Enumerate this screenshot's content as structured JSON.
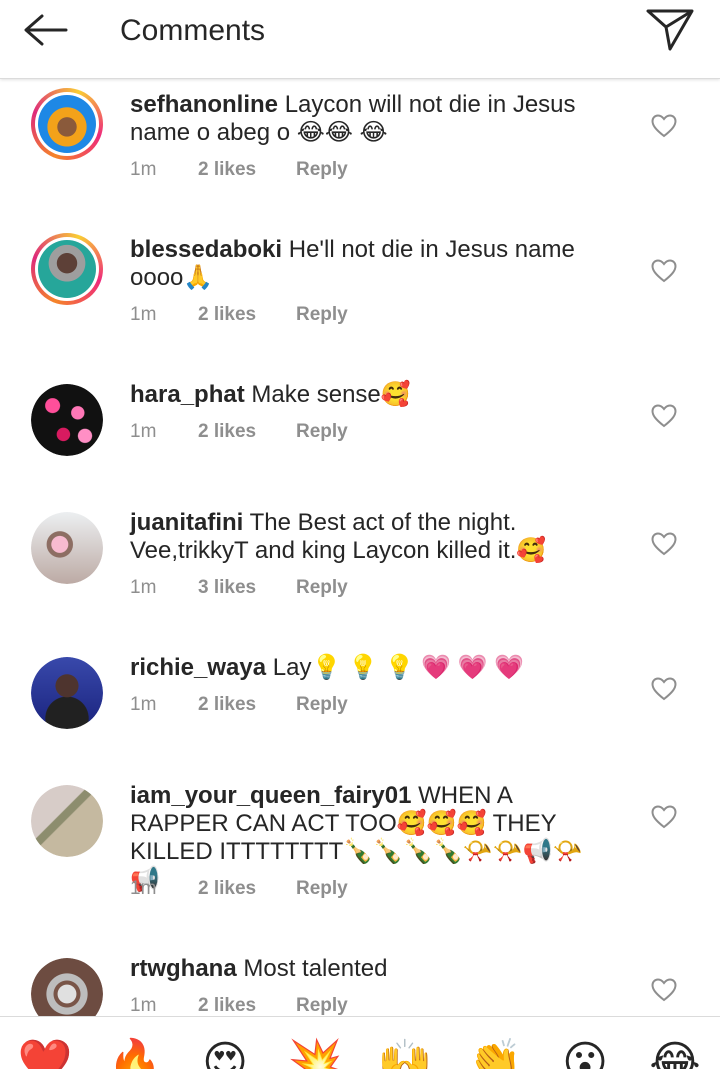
{
  "header": {
    "title": "Comments"
  },
  "comments": [
    {
      "user": "sefhanonline",
      "text": "Laycon will not die in Jesus name o abeg o 😂😂 😂",
      "time": "1m",
      "likes": "2 likes",
      "reply": "Reply"
    },
    {
      "user": "blessedaboki",
      "text": "He'll not die in Jesus name oooo🙏",
      "time": "1m",
      "likes": "2 likes",
      "reply": "Reply"
    },
    {
      "user": "hara_phat",
      "text": "Make sense🥰",
      "time": "1m",
      "likes": "2 likes",
      "reply": "Reply"
    },
    {
      "user": "juanitafini",
      "text": "The Best act of the night. Vee,trikkyT and king Laycon killed it.🥰",
      "time": "1m",
      "likes": "3 likes",
      "reply": "Reply"
    },
    {
      "user": "richie_waya",
      "text": "Lay💡 💡 💡 💗 💗 💗",
      "time": "1m",
      "likes": "2 likes",
      "reply": "Reply"
    },
    {
      "user": "iam_your_queen_fairy01",
      "text": "WHEN A RAPPER CAN ACT  TOO🥰🥰🥰 THEY KILLED ITTTTTTTT🍾🍾🍾🍾📯📯📢📯📢",
      "time": "1m",
      "likes": "2 likes",
      "reply": "Reply"
    },
    {
      "user": "rtwghana",
      "text": "Most talented",
      "time": "1m",
      "likes": "2 likes",
      "reply": "Reply"
    }
  ],
  "quick_reactions": [
    "❤️",
    "🔥",
    "😍",
    "💥",
    "🙌",
    "👏",
    "😮",
    "😂"
  ],
  "colors": {
    "accent": "#262626",
    "meta": "#8e8e8e",
    "heart_outline": "#8e8e8e"
  }
}
